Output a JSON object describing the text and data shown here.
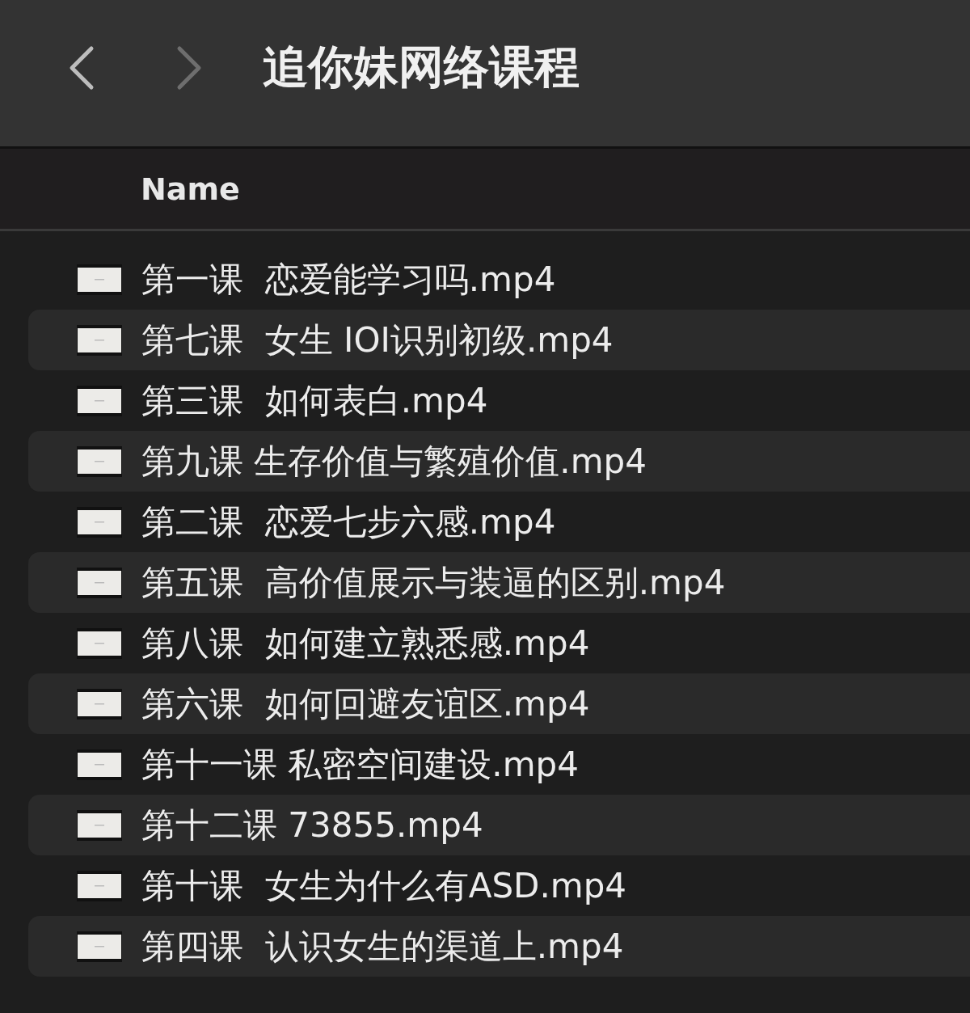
{
  "toolbar": {
    "back": {
      "disabled": false
    },
    "forward": {
      "disabled": true
    },
    "title": "追你妹网络课程"
  },
  "table": {
    "columns": [
      "Name"
    ],
    "rows": [
      {
        "name": "第一课  恋爱能学习吗.mp4"
      },
      {
        "name": "第七课  女生 IOI识别初级.mp4"
      },
      {
        "name": "第三课  如何表白.mp4"
      },
      {
        "name": "第九课 生存价值与繁殖价值.mp4"
      },
      {
        "name": "第二课  恋爱七步六感.mp4"
      },
      {
        "name": "第五课  高价值展示与装逼的区别.mp4"
      },
      {
        "name": "第八课  如何建立熟悉感.mp4"
      },
      {
        "name": "第六课  如何回避友谊区.mp4"
      },
      {
        "name": "第十一课 私密空间建设.mp4"
      },
      {
        "name": "第十二课 73855.mp4"
      },
      {
        "name": "第十课  女生为什么有ASD.mp4"
      },
      {
        "name": "第四课  认识女生的渠道上.mp4"
      }
    ]
  }
}
